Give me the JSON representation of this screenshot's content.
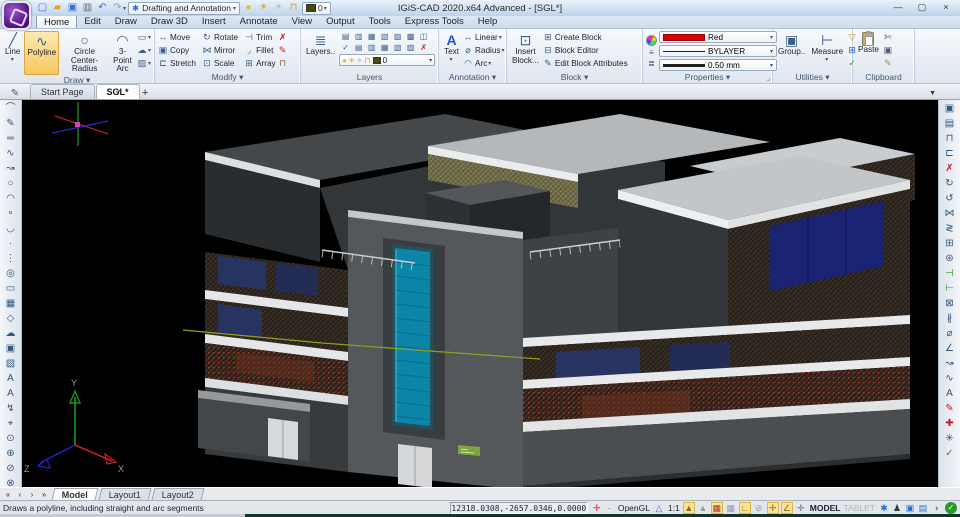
{
  "icons": {
    "chevron_down": "▾",
    "dropdown": "▼",
    "plus": "+",
    "pencil": "✎",
    "launcher": "⌟"
  },
  "titlebar": {
    "title": "IGiS-CAD 2020.x64 Advanced  - [SGL*]",
    "qat": [
      {
        "name": "new-file-icon",
        "glyph": "▢",
        "color": "#3a6fd0"
      },
      {
        "name": "open-folder-icon",
        "glyph": "▰",
        "color": "#e8a020"
      },
      {
        "name": "save-icon",
        "glyph": "▣",
        "color": "#3a6fd0"
      },
      {
        "name": "plot-preview-icon",
        "glyph": "▥",
        "color": "#667"
      },
      {
        "name": "undo-icon",
        "glyph": "↶",
        "color": "#3a6fd0"
      },
      {
        "name": "redo-icon",
        "glyph": "↷",
        "color": "#7aa0d8"
      }
    ],
    "workspace": {
      "gear_glyph": "✱",
      "label": "Drafting and Annotation"
    },
    "layer_quick": [
      {
        "name": "bulb-icon",
        "glyph": "●",
        "color": "#e8c020"
      },
      {
        "name": "sun-icon",
        "glyph": "☀",
        "color": "#e8a020"
      },
      {
        "name": "freeze-icon",
        "glyph": "☀",
        "color": "#b8bec6"
      },
      {
        "name": "unlock-icon",
        "glyph": "⊓",
        "color": "#c8a040"
      }
    ],
    "layer_value": "0",
    "window_buttons": {
      "minimize": "—",
      "maximize": "▢",
      "close": "×"
    }
  },
  "menu": {
    "tabs": [
      {
        "label": "Home",
        "active": true
      },
      {
        "label": "Edit"
      },
      {
        "label": "Draw"
      },
      {
        "label": "Draw 3D"
      },
      {
        "label": "Insert"
      },
      {
        "label": "Annotate"
      },
      {
        "label": "View"
      },
      {
        "label": "Output"
      },
      {
        "label": "Tools"
      },
      {
        "label": "Express Tools"
      },
      {
        "label": "Help"
      }
    ]
  },
  "ribbon": {
    "draw": {
      "label": "Draw",
      "line": {
        "label": "Line",
        "glyph": "╱"
      },
      "polyline": {
        "label": "Polyline",
        "glyph": "∿"
      },
      "circle": {
        "label1": "Circle",
        "label2": "Center-Radius",
        "glyph": "○"
      },
      "arc": {
        "label1": "3-Point",
        "label2": "Arc",
        "glyph": "◠"
      },
      "small": [
        {
          "name": "rectangle-button",
          "glyph": "▭"
        },
        {
          "name": "revcloud-button",
          "glyph": "☁"
        },
        {
          "name": "hatch-button",
          "glyph": "▨"
        }
      ]
    },
    "modify": {
      "label": "Modify",
      "grid": [
        {
          "name": "move-button",
          "glyph": "↔",
          "label": "Move"
        },
        {
          "name": "rotate-button",
          "glyph": "↻",
          "label": "Rotate"
        },
        {
          "name": "trim-button",
          "glyph": "⊣",
          "label": "Trim"
        },
        {
          "name": "copy-button",
          "glyph": "▣",
          "label": "Copy"
        },
        {
          "name": "mirror-button",
          "glyph": "⋈",
          "label": "Mirror"
        },
        {
          "name": "fillet-button",
          "glyph": "◞",
          "label": "Fillet",
          "menu": true
        },
        {
          "name": "stretch-button",
          "glyph": "⊏",
          "label": "Stretch"
        },
        {
          "name": "scale-button",
          "glyph": "⊡",
          "label": "Scale"
        },
        {
          "name": "array-button",
          "glyph": "⊞",
          "label": "Array",
          "menu": true
        }
      ],
      "side": [
        {
          "name": "erase-button",
          "glyph": "✗",
          "color": "#c41e1e"
        },
        {
          "name": "matchprop-button",
          "glyph": "✎",
          "color": "#c41e1e"
        },
        {
          "name": "lock-button",
          "glyph": "⊓",
          "color": "#8a6a2a"
        }
      ]
    },
    "layers": {
      "label": "Layers",
      "big_label": "Layers..",
      "big_glyph": "≣",
      "grid": [
        {
          "name": "layer-tool-1",
          "glyph": "▤"
        },
        {
          "name": "layer-tool-2",
          "glyph": "▥"
        },
        {
          "name": "layer-tool-3",
          "glyph": "▦"
        },
        {
          "name": "layer-tool-4",
          "glyph": "▧"
        },
        {
          "name": "layer-tool-5",
          "glyph": "▨"
        },
        {
          "name": "layer-tool-6",
          "glyph": "▩"
        },
        {
          "name": "layer-tool-7",
          "glyph": "◫"
        },
        {
          "name": "layer-tool-8",
          "glyph": "✓"
        },
        {
          "name": "layer-tool-9",
          "glyph": "▤"
        },
        {
          "name": "layer-tool-10",
          "glyph": "▥"
        },
        {
          "name": "layer-tool-11",
          "glyph": "▦"
        },
        {
          "name": "layer-tool-12",
          "glyph": "▧"
        },
        {
          "name": "layer-tool-13",
          "glyph": "▨"
        },
        {
          "name": "layer-tool-14",
          "glyph": "✗",
          "color": "#c41e1e"
        }
      ],
      "combo_layer": "0",
      "combo_icons": [
        {
          "name": "bulb-icon",
          "glyph": "●",
          "color": "#e8c020"
        },
        {
          "name": "sun-icon",
          "glyph": "☀",
          "color": "#e8a020"
        },
        {
          "name": "freeze-icon",
          "glyph": "☀",
          "color": "#b8bec6"
        },
        {
          "name": "unlock-icon",
          "glyph": "⊓",
          "color": "#c8a040"
        }
      ]
    },
    "annotation": {
      "label": "Annotation",
      "text_button": {
        "label": "Text",
        "glyph": "A"
      },
      "rows": [
        {
          "name": "linear-dim-button",
          "glyph": "↔",
          "label": "Linear",
          "menu": true
        },
        {
          "name": "radius-dim-button",
          "glyph": "⌀",
          "label": "Radius",
          "menu": true
        },
        {
          "name": "arc-dim-button",
          "glyph": "◠",
          "label": "Arc"
        }
      ]
    },
    "block": {
      "label": "Block",
      "insert": {
        "label1": "Insert",
        "label2": "Block...",
        "glyph": "⊡"
      },
      "rows": [
        {
          "name": "create-block-button",
          "glyph": "⊞",
          "label": "Create Block"
        },
        {
          "name": "block-editor-button",
          "glyph": "⊟",
          "label": "Block Editor"
        },
        {
          "name": "edit-attributes-button",
          "glyph": "✎",
          "label": "Edit Block Attributes"
        }
      ]
    },
    "properties": {
      "label": "Properties",
      "color_value": "Red",
      "linetype_value": "BYLAYER",
      "lineweight_value": "0.50 mm"
    },
    "utilities": {
      "label": "Utilities",
      "group": {
        "label": "Group..",
        "glyph": "▣"
      },
      "measure": {
        "label": "Measure",
        "glyph": "⊢",
        "menu": true
      },
      "small": [
        {
          "name": "quick-select-button",
          "glyph": "▽",
          "color": "#c8a020"
        },
        {
          "name": "point-style-button",
          "glyph": "⊞",
          "color": "#2255cc"
        },
        {
          "name": "validate-button",
          "glyph": "✓",
          "color": "#2a9a2a"
        }
      ]
    },
    "clipboard": {
      "label": "Clipboard",
      "paste_label": "Paste",
      "small": [
        {
          "name": "cut-button",
          "glyph": "✄",
          "color": "#556"
        },
        {
          "name": "copy-clipboard-button",
          "glyph": "▣",
          "color": "#557"
        },
        {
          "name": "format-brush-button",
          "glyph": "✎",
          "color": "#b8862a"
        }
      ]
    }
  },
  "doc_tabs": {
    "tabs": [
      {
        "label": "Start Page",
        "active": false,
        "closable": false
      },
      {
        "label": "SGL*",
        "active": true,
        "closable": true
      }
    ]
  },
  "toolbars": {
    "left": [
      {
        "name": "polyline-arc-icon",
        "glyph": "⌒"
      },
      {
        "name": "sketch-icon",
        "glyph": "✎"
      },
      {
        "name": "multiline-icon",
        "glyph": "═"
      },
      {
        "name": "spline-icon",
        "glyph": "∿"
      },
      {
        "name": "polyline-edit-icon",
        "glyph": "↝"
      },
      {
        "name": "circle-icon",
        "glyph": "○"
      },
      {
        "name": "arc-icon",
        "glyph": "◠"
      },
      {
        "name": "circle-ttr-icon",
        "glyph": "∘"
      },
      {
        "name": "arc-continue-icon",
        "glyph": "◡"
      },
      {
        "name": "point-icon",
        "glyph": "·"
      },
      {
        "name": "divide-icon",
        "glyph": "⋮"
      },
      {
        "name": "donut-icon",
        "glyph": "◎"
      },
      {
        "name": "rectangle-icon",
        "glyph": "▭"
      },
      {
        "name": "image-icon",
        "glyph": "▦"
      },
      {
        "name": "polygon-icon",
        "glyph": "◇"
      },
      {
        "name": "revcloud-icon",
        "glyph": "☁"
      },
      {
        "name": "block-icon",
        "glyph": "▣"
      },
      {
        "name": "hatch-icon",
        "glyph": "▨"
      },
      {
        "name": "text-icon",
        "glyph": "A"
      },
      {
        "name": "mtext-icon",
        "glyph": "A"
      },
      {
        "name": "flip-icon",
        "glyph": "↯"
      },
      {
        "name": "pan-icon",
        "glyph": "⌖"
      },
      {
        "name": "zoom-realtime-icon",
        "glyph": "⊙"
      },
      {
        "name": "zoom-window-icon",
        "glyph": "⊕"
      },
      {
        "name": "zoom-previous-icon",
        "glyph": "⊘"
      },
      {
        "name": "zoom-extents-icon",
        "glyph": "⊗"
      }
    ],
    "right": [
      {
        "name": "copy-object-icon",
        "glyph": "▣"
      },
      {
        "name": "paste-special-icon",
        "glyph": "▤"
      },
      {
        "name": "lock-objects-icon",
        "glyph": "⊓"
      },
      {
        "name": "stretch-icon",
        "glyph": "⊏"
      },
      {
        "name": "erase-icon",
        "glyph": "✗",
        "color": "#c41e1e"
      },
      {
        "name": "rotate-icon",
        "glyph": "↻"
      },
      {
        "name": "rotate-3d-icon",
        "glyph": "↺"
      },
      {
        "name": "mirror-icon",
        "glyph": "⋈"
      },
      {
        "name": "mirror-3d-icon",
        "glyph": "≷"
      },
      {
        "name": "array-rect-icon",
        "glyph": "⊞"
      },
      {
        "name": "array-polar-icon",
        "glyph": "⊛"
      },
      {
        "name": "trim-icon",
        "glyph": "⊣",
        "color": "#2a9a2a"
      },
      {
        "name": "extend-icon",
        "glyph": "⊢",
        "color": "#2a9a2a"
      },
      {
        "name": "box-3d-icon",
        "glyph": "⊠"
      },
      {
        "name": "break-icon",
        "glyph": "∦"
      },
      {
        "name": "measure-icon",
        "glyph": "⌀"
      },
      {
        "name": "chamfer-icon",
        "glyph": "∠"
      },
      {
        "name": "pedit-icon",
        "glyph": "↝"
      },
      {
        "name": "spline-edit-icon",
        "glyph": "∿"
      },
      {
        "name": "text-edit-icon",
        "glyph": "A"
      },
      {
        "name": "matchprop-icon",
        "glyph": "✎",
        "color": "#c41e1e"
      },
      {
        "name": "match-add-icon",
        "glyph": "✚",
        "color": "#c41e1e"
      },
      {
        "name": "explode-icon",
        "glyph": "✳"
      },
      {
        "name": "purge-icon",
        "glyph": "✓",
        "color": "#2a9a2a"
      }
    ]
  },
  "viewport": {
    "axes": {
      "x": "X",
      "y": "Y",
      "z": "Z"
    }
  },
  "layout_bar": {
    "nav": [
      {
        "name": "first-layout-nav",
        "glyph": "«"
      },
      {
        "name": "prev-layout-nav",
        "glyph": "‹"
      },
      {
        "name": "next-layout-nav",
        "glyph": "›"
      },
      {
        "name": "last-layout-nav",
        "glyph": "»"
      }
    ],
    "tabs": [
      {
        "label": "Model",
        "active": true
      },
      {
        "label": "Layout1"
      },
      {
        "label": "Layout2"
      }
    ]
  },
  "status_bar": {
    "help": "Draws a polyline, including straight and arc segments",
    "coordinates": "12318.0308,-2657.0346,0.0000",
    "opengl_label": "OpenGL",
    "scale_label": "1:1",
    "model_label": "MODEL",
    "tablet_label": "TABLET",
    "icons_a": [
      {
        "name": "crosshair-icon",
        "glyph": "✛",
        "color": "#c03030"
      },
      {
        "name": "snap-marker-icon",
        "glyph": "∙",
        "color": "#cc33cc"
      }
    ],
    "icons_b": [
      {
        "name": "annotation-scale-icon",
        "glyph": "△",
        "color": "#2a6fd4"
      }
    ],
    "toggles": [
      {
        "name": "annotation-visibility-toggle",
        "glyph": "▲",
        "on": true,
        "color": "#8a6d1a"
      },
      {
        "name": "autoscale-toggle",
        "glyph": "▲",
        "on": false,
        "color": "#99a"
      },
      {
        "name": "snap-toggle",
        "glyph": "▦",
        "on": true,
        "color": "#a33030"
      },
      {
        "name": "grid-toggle",
        "glyph": "▦",
        "on": false,
        "color": "#99a"
      },
      {
        "name": "ortho-toggle",
        "glyph": "∟",
        "on": true,
        "color": "#8a6d1a"
      },
      {
        "name": "polar-toggle",
        "glyph": "⊘",
        "on": false,
        "color": "#99a"
      },
      {
        "name": "osnap-toggle",
        "glyph": "✛",
        "on": true,
        "color": "#8a6d1a"
      },
      {
        "name": "otrack-toggle",
        "glyph": "∠",
        "on": true,
        "color": "#8a6d1a"
      },
      {
        "name": "dynucs-toggle",
        "glyph": "✛",
        "on": false,
        "color": "#667"
      }
    ],
    "icons_d": [
      {
        "name": "settings-gear-icon",
        "glyph": "✱",
        "color": "#2a6fd4"
      },
      {
        "name": "user-icon",
        "glyph": "♟",
        "color": "#333344"
      },
      {
        "name": "clean-screen-icon",
        "glyph": "▣",
        "color": "#2a6fd4"
      },
      {
        "name": "layout-switch-icon",
        "glyph": "▤",
        "color": "#2a6fd4"
      },
      {
        "name": "performance-icon",
        "glyph": "◑",
        "color": "#889"
      }
    ],
    "ok_icon": {
      "name": "status-ok-icon",
      "glyph": "✓"
    }
  }
}
